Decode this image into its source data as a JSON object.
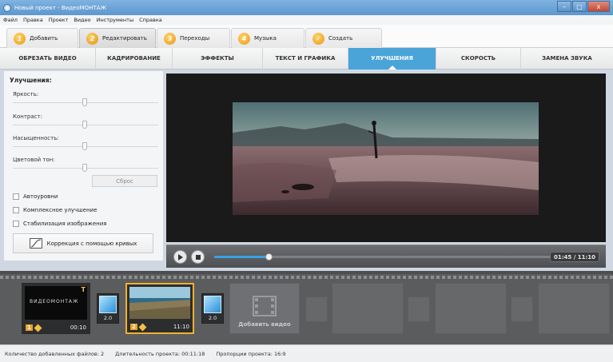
{
  "window": {
    "title": "Новый проект - ВидеоМОНТАЖ",
    "buttons": {
      "minimize": "–",
      "maximize": "□",
      "close": "x"
    }
  },
  "menu": [
    "Файл",
    "Правка",
    "Проект",
    "Видео",
    "Инструменты",
    "Справка"
  ],
  "steps": [
    {
      "num": "1",
      "label": "Добавить"
    },
    {
      "num": "2",
      "label": "Редактировать",
      "active": true
    },
    {
      "num": "3",
      "label": "Переходы"
    },
    {
      "num": "4",
      "label": "Музыка"
    },
    {
      "num": "✓",
      "label": "Создать"
    }
  ],
  "tabs": [
    {
      "label": "ОБРЕЗАТЬ ВИДЕО"
    },
    {
      "label": "КАДРИРОВАНИЕ"
    },
    {
      "label": "ЭФФЕКТЫ"
    },
    {
      "label": "ТЕКСТ И ГРАФИКА"
    },
    {
      "label": "УЛУЧШЕНИЯ",
      "active": true
    },
    {
      "label": "СКОРОСТЬ"
    },
    {
      "label": "ЗАМЕНА ЗВУКА"
    }
  ],
  "enhance": {
    "heading": "Улучшения:",
    "brightness": {
      "label": "Яркость:",
      "value": 0.5
    },
    "contrast": {
      "label": "Контраст:",
      "value": 0.5
    },
    "saturation": {
      "label": "Насыщенность:",
      "value": 0.5
    },
    "hue": {
      "label": "Цветовой тон:",
      "value": 0.5
    },
    "reset_label": "Сброс",
    "checkboxes": [
      {
        "label": "Автоуровни",
        "checked": false
      },
      {
        "label": "Комплексное улучшение",
        "checked": false
      },
      {
        "label": "Стабилизация изображения",
        "checked": false
      }
    ],
    "curves_label": "Коррекция с помощью кривых"
  },
  "player": {
    "progress": 0.16,
    "time": "01:45 / 11:10"
  },
  "timeline": {
    "clips": [
      {
        "num": "1",
        "duration": "00:10",
        "title_text": "ВИДЕОМОНТАЖ",
        "badge": "T"
      },
      {
        "num": "2",
        "duration": "11:10"
      }
    ],
    "transitions": [
      {
        "value": "2.0"
      },
      {
        "value": "2.0"
      }
    ],
    "add_video_label": "Добавить видео"
  },
  "status": {
    "files": "Количество добавленных файлов: 2",
    "duration": "Длительность проекта: 00:11:18",
    "ratio": "Пропорции проекта: 16:9"
  },
  "colors": {
    "accent": "#4aa4d8",
    "step_orange": "#e89814",
    "selected_clip": "#f5b02a",
    "progress": "#3aa2e8"
  }
}
